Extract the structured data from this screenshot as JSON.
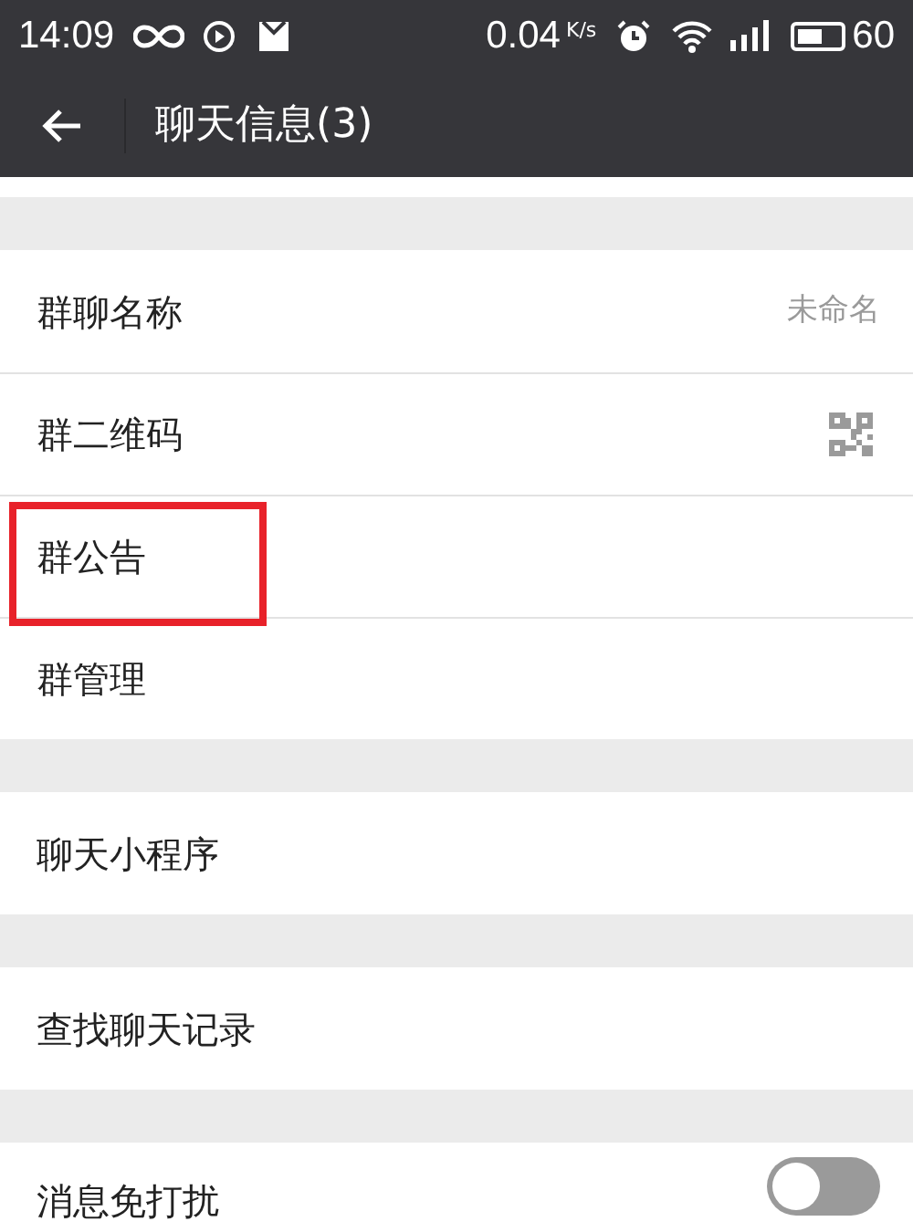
{
  "status_bar": {
    "time": "14:09",
    "speed": "0.04",
    "speed_unit": "K/s",
    "battery": "60"
  },
  "header": {
    "title": "聊天信息(3)"
  },
  "sections": [
    {
      "items": [
        {
          "kind": "value",
          "label": "群聊名称",
          "value": "未命名",
          "highlighted": false
        },
        {
          "kind": "qr",
          "label": "群二维码",
          "highlighted": false
        },
        {
          "kind": "plain",
          "label": "群公告",
          "highlighted": true
        },
        {
          "kind": "plain",
          "label": "群管理",
          "highlighted": false
        }
      ]
    },
    {
      "items": [
        {
          "kind": "plain",
          "label": "聊天小程序",
          "highlighted": false
        }
      ]
    },
    {
      "items": [
        {
          "kind": "plain",
          "label": "查找聊天记录",
          "highlighted": false
        }
      ]
    },
    {
      "items": [
        {
          "kind": "toggle",
          "label": "消息免打扰",
          "on": false,
          "highlighted": false
        }
      ]
    }
  ]
}
